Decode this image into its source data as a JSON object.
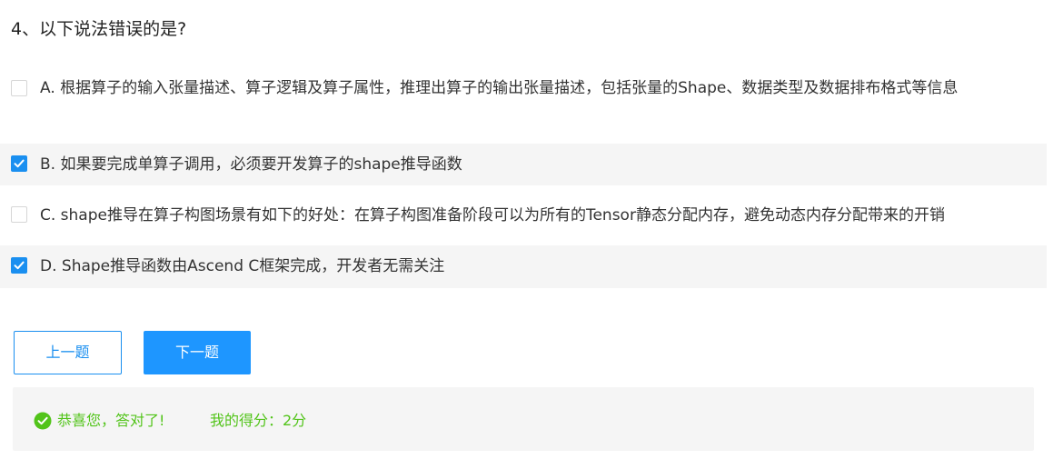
{
  "question": {
    "title": "4、以下说法错误的是?"
  },
  "options": [
    {
      "label": "A. 根据算子的输入张量描述、算子逻辑及算子属性，推理出算子的输出张量描述，包括张量的Shape、数据类型及数据排布格式等信息",
      "checked": false
    },
    {
      "label": "B. 如果要完成单算子调用，必须要开发算子的shape推导函数",
      "checked": true
    },
    {
      "label": "C. shape推导在算子构图场景有如下的好处：在算子构图准备阶段可以为所有的Tensor静态分配内存，避免动态内存分配带来的开销",
      "checked": false
    },
    {
      "label": "D. Shape推导函数由Ascend C框架完成，开发者无需关注",
      "checked": true
    }
  ],
  "buttons": {
    "prev_label": "上一题",
    "next_label": "下一题"
  },
  "result": {
    "message": "恭喜您，答对了!",
    "score": "我的得分：2分"
  },
  "colors": {
    "accent": "#1a8ff0",
    "primary_button": "#1e96ff",
    "success": "#52c41a",
    "selected_row_bg": "#f5f5f5"
  },
  "icons": {
    "checkbox_checked": "check-icon",
    "result": "check-circle-icon"
  }
}
